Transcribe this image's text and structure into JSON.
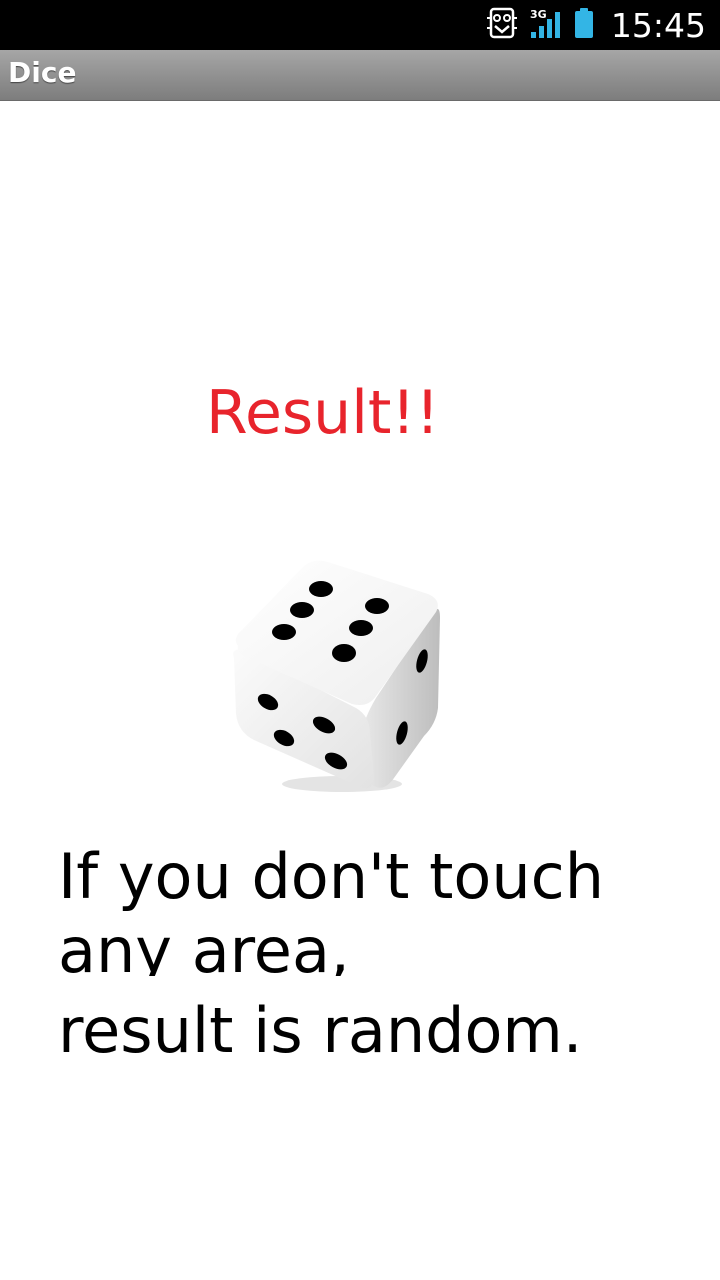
{
  "status_bar": {
    "network": "3G",
    "time": "15:45",
    "icons": [
      "sim-toolkit-icon",
      "signal-icon",
      "battery-icon"
    ]
  },
  "app": {
    "title": "Dice"
  },
  "main": {
    "result_heading": "Result!!",
    "result_color": "#e8242c",
    "hint_lines": [
      "If you don't touch",
      "any area,",
      "result is random."
    ]
  },
  "dice": {
    "top_face": 6,
    "front_face": 4,
    "right_face": 2
  }
}
